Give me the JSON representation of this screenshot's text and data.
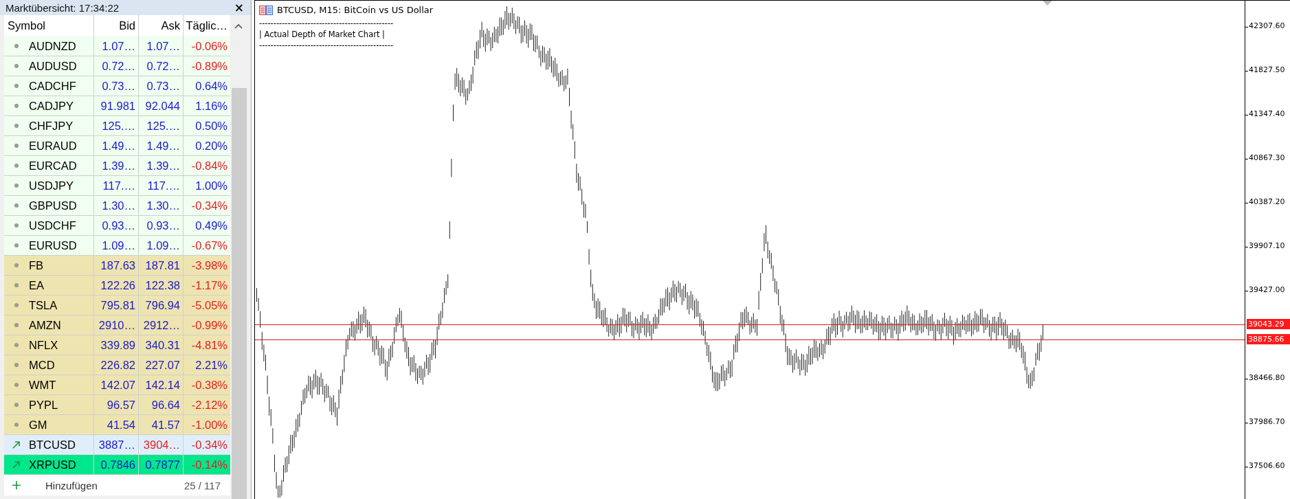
{
  "market_watch": {
    "title": "Marktübersicht: 17:34:22",
    "close": "×",
    "columns": [
      "Symbol",
      "Bid",
      "Ask",
      "Täglic…"
    ],
    "rows": [
      {
        "kind": "dot",
        "symbol": "AUDNZD",
        "color": "#f0fff0",
        "bid": {
          "text": "1.07…",
          "down": false
        },
        "ask": {
          "text": "1.07…",
          "down": false
        },
        "change": {
          "text": "-0.06%",
          "down": true
        }
      },
      {
        "kind": "dot",
        "symbol": "AUDUSD",
        "color": "#f0fff0",
        "bid": {
          "text": "0.72…",
          "down": false
        },
        "ask": {
          "text": "0.72…",
          "down": false
        },
        "change": {
          "text": "-0.89%",
          "down": true
        }
      },
      {
        "kind": "dot",
        "symbol": "CADCHF",
        "color": "#f0fff0",
        "bid": {
          "text": "0.73…",
          "down": false
        },
        "ask": {
          "text": "0.73…",
          "down": false
        },
        "change": {
          "text": "0.64%",
          "down": false
        }
      },
      {
        "kind": "dot",
        "symbol": "CADJPY",
        "color": "#f0fff0",
        "bid": {
          "text": "91.981",
          "down": false
        },
        "ask": {
          "text": "92.044",
          "down": false
        },
        "change": {
          "text": "1.16%",
          "down": false
        }
      },
      {
        "kind": "dot",
        "symbol": "CHFJPY",
        "color": "#f0fff0",
        "bid": {
          "text": "125.…",
          "down": false
        },
        "ask": {
          "text": "125.…",
          "down": false
        },
        "change": {
          "text": "0.50%",
          "down": false
        }
      },
      {
        "kind": "dot",
        "symbol": "EURAUD",
        "color": "#f0fff0",
        "bid": {
          "text": "1.49…",
          "down": false
        },
        "ask": {
          "text": "1.49…",
          "down": false
        },
        "change": {
          "text": "0.20%",
          "down": false
        }
      },
      {
        "kind": "dot",
        "symbol": "EURCAD",
        "color": "#f0fff0",
        "bid": {
          "text": "1.39…",
          "down": false
        },
        "ask": {
          "text": "1.39…",
          "down": false
        },
        "change": {
          "text": "-0.84%",
          "down": true
        }
      },
      {
        "kind": "dot",
        "symbol": "USDJPY",
        "color": "#f0fff0",
        "bid": {
          "text": "117.…",
          "down": false
        },
        "ask": {
          "text": "117.…",
          "down": false
        },
        "change": {
          "text": "1.00%",
          "down": false
        }
      },
      {
        "kind": "dot",
        "symbol": "GBPUSD",
        "color": "#f0fff0",
        "bid": {
          "text": "1.30…",
          "down": false
        },
        "ask": {
          "text": "1.30…",
          "down": false
        },
        "change": {
          "text": "-0.34%",
          "down": true
        }
      },
      {
        "kind": "dot",
        "symbol": "USDCHF",
        "color": "#f0fff0",
        "bid": {
          "text": "0.93…",
          "down": false
        },
        "ask": {
          "text": "0.93…",
          "down": false
        },
        "change": {
          "text": "0.49%",
          "down": false
        }
      },
      {
        "kind": "dot",
        "symbol": "EURUSD",
        "color": "#f0fff0",
        "bid": {
          "text": "1.09…",
          "down": false
        },
        "ask": {
          "text": "1.09…",
          "down": false
        },
        "change": {
          "text": "-0.67%",
          "down": true
        }
      },
      {
        "kind": "dot",
        "symbol": "FB",
        "color": "#eee4b0",
        "bid": {
          "text": "187.63",
          "down": false
        },
        "ask": {
          "text": "187.81",
          "down": false
        },
        "change": {
          "text": "-3.98%",
          "down": true
        }
      },
      {
        "kind": "dot",
        "symbol": "EA",
        "color": "#eee4b0",
        "bid": {
          "text": "122.26",
          "down": false
        },
        "ask": {
          "text": "122.38",
          "down": false
        },
        "change": {
          "text": "-1.17%",
          "down": true
        }
      },
      {
        "kind": "dot",
        "symbol": "TSLA",
        "color": "#eee4b0",
        "bid": {
          "text": "795.81",
          "down": false
        },
        "ask": {
          "text": "796.94",
          "down": false
        },
        "change": {
          "text": "-5.05%",
          "down": true
        }
      },
      {
        "kind": "dot",
        "symbol": "AMZN",
        "color": "#eee4b0",
        "bid": {
          "text": "2910…",
          "down": false
        },
        "ask": {
          "text": "2912…",
          "down": false
        },
        "change": {
          "text": "-0.99%",
          "down": true
        }
      },
      {
        "kind": "dot",
        "symbol": "NFLX",
        "color": "#eee4b0",
        "bid": {
          "text": "339.89",
          "down": false
        },
        "ask": {
          "text": "340.31",
          "down": false
        },
        "change": {
          "text": "-4.81%",
          "down": true
        }
      },
      {
        "kind": "dot",
        "symbol": "MCD",
        "color": "#eee4b0",
        "bid": {
          "text": "226.82",
          "down": false
        },
        "ask": {
          "text": "227.07",
          "down": false
        },
        "change": {
          "text": "2.21%",
          "down": false
        }
      },
      {
        "kind": "dot",
        "symbol": "WMT",
        "color": "#eee4b0",
        "bid": {
          "text": "142.07",
          "down": false
        },
        "ask": {
          "text": "142.14",
          "down": false
        },
        "change": {
          "text": "-0.38%",
          "down": true
        }
      },
      {
        "kind": "dot",
        "symbol": "PYPL",
        "color": "#eee4b0",
        "bid": {
          "text": "96.57",
          "down": false
        },
        "ask": {
          "text": "96.64",
          "down": false
        },
        "change": {
          "text": "-2.12%",
          "down": true
        }
      },
      {
        "kind": "dot",
        "symbol": "GM",
        "color": "#eee4b0",
        "bid": {
          "text": "41.54",
          "down": false
        },
        "ask": {
          "text": "41.57",
          "down": false
        },
        "change": {
          "text": "-1.00%",
          "down": true
        }
      },
      {
        "kind": "arrow",
        "symbol": "BTCUSD",
        "color": "#e0eefb",
        "bid": {
          "text": "3887…",
          "down": false
        },
        "ask": {
          "text": "3904…",
          "down": true
        },
        "change": {
          "text": "-0.34%",
          "down": true
        }
      },
      {
        "kind": "arrow",
        "symbol": "XRPUSD",
        "color": "#00e68c",
        "bid": {
          "text": "0.7846",
          "down": false
        },
        "ask": {
          "text": "0.7877",
          "down": false
        },
        "change": {
          "text": "-0.14%",
          "down": true
        }
      }
    ],
    "footer": {
      "add": "Hinzufügen",
      "count": "25 / 117"
    }
  },
  "chart": {
    "title": "BTCUSD, M15:  BitCoin vs US Dollar",
    "comment": [
      "-----------------------------------------------",
      "| Actual Depth of Market Chart |",
      "-----------------------------------------------"
    ],
    "price_ticks": [
      "42307.60",
      "41827.50",
      "41347.40",
      "40867.30",
      "40387.20",
      "39907.10",
      "39427.00",
      "38466.80",
      "37986.70",
      "37506.60"
    ],
    "price_lines": [
      {
        "label": "39043.29"
      },
      {
        "label": "38875.66"
      }
    ]
  }
}
